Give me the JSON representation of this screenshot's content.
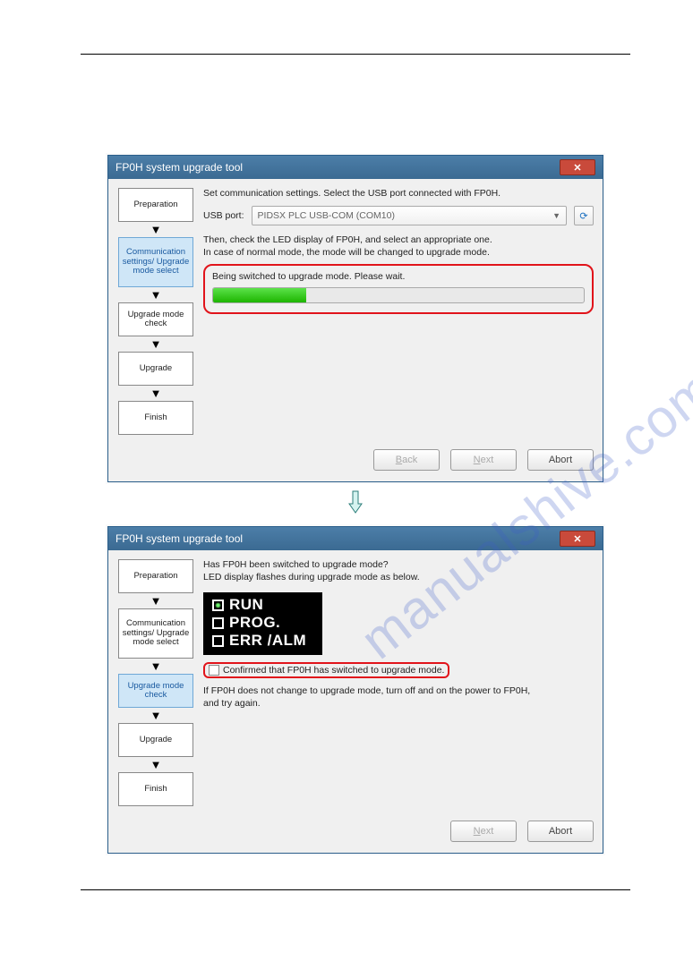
{
  "watermark": "manualshive.com",
  "window_title": "FP0H system upgrade tool",
  "steps": {
    "s1": "Preparation",
    "s2": "Communication settings/ Upgrade mode select",
    "s3": "Upgrade mode check",
    "s4": "Upgrade",
    "s5": "Finish"
  },
  "screen1": {
    "instr": "Set communication settings. Select the USB port connected with FP0H.",
    "usb_label": "USB port:",
    "usb_value": "PIDSX PLC USB-COM (COM10)",
    "note1": "Then, check the LED display of FP0H, and select an appropriate one.",
    "note2": "In case of normal mode, the mode will be changed to upgrade mode.",
    "status": "Being switched to upgrade mode. Please wait.",
    "btn_back": "Back",
    "btn_next": "Next",
    "btn_abort": "Abort"
  },
  "screen2": {
    "q1": "Has FP0H been switched to upgrade mode?",
    "q2": "LED display flashes during upgrade mode as below.",
    "led": {
      "run": "RUN",
      "prog": "PROG.",
      "err": "ERR /ALM"
    },
    "confirm": "Confirmed that FP0H has switched to upgrade mode.",
    "note1": "If FP0H does not change to upgrade mode, turn off and on the power to FP0H,",
    "note2": "and try again.",
    "btn_next": "Next",
    "btn_abort": "Abort"
  }
}
